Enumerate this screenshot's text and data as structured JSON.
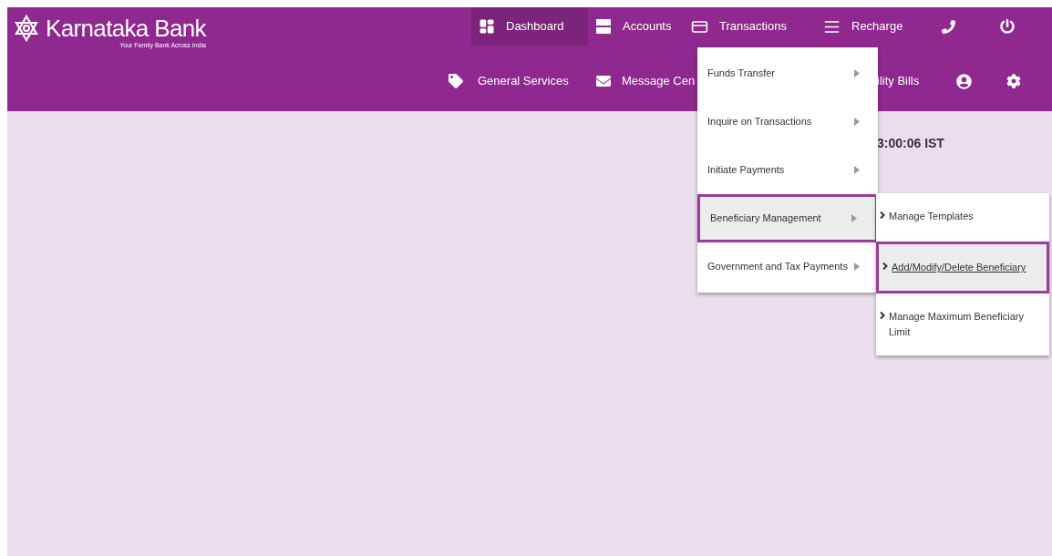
{
  "brand": {
    "name": "Karnataka Bank",
    "tagline": "Your Family Bank Across India"
  },
  "nav_top": [
    {
      "label": "Dashboard",
      "selected": true
    },
    {
      "label": "Accounts",
      "selected": false
    },
    {
      "label": "Transactions",
      "selected": false
    },
    {
      "label": "Recharge",
      "selected": false
    }
  ],
  "nav_bottom": [
    {
      "label": "General Services"
    },
    {
      "label": "Message Cen"
    },
    {
      "label": "ility Bills"
    }
  ],
  "clock": "3:00:06 IST",
  "menu": [
    {
      "label": "Funds Transfer",
      "selected": false
    },
    {
      "label": "Inquire on Transactions",
      "selected": false
    },
    {
      "label": "Initiate Payments",
      "selected": false
    },
    {
      "label": "Beneficiary Management",
      "selected": true
    },
    {
      "label": "Government and Tax Payments",
      "selected": false
    }
  ],
  "submenu": [
    {
      "label": "Manage Templates",
      "selected": false
    },
    {
      "label": "Add/Modify/Delete Beneficiary",
      "selected": true
    },
    {
      "label": "Manage Maximum Beneficiary Limit",
      "selected": false
    }
  ]
}
